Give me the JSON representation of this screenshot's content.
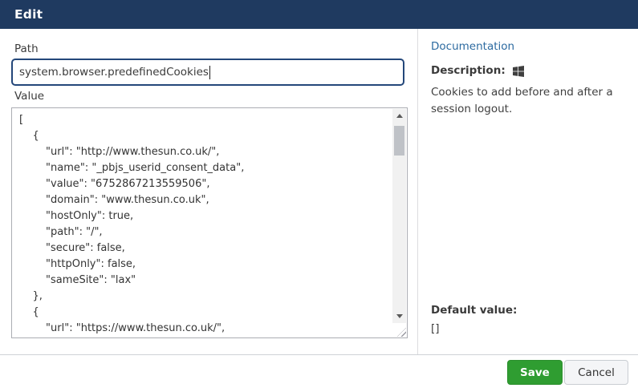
{
  "dialog": {
    "title": "Edit"
  },
  "form": {
    "path_label": "Path",
    "path_value": "system.browser.predefinedCookies",
    "value_label": "Value",
    "value_content": "[\n    {\n        \"url\": \"http://www.thesun.co.uk/\",\n        \"name\": \"_pbjs_userid_consent_data\",\n        \"value\": \"6752867213559506\",\n        \"domain\": \"www.thesun.co.uk\",\n        \"hostOnly\": true,\n        \"path\": \"/\",\n        \"secure\": false,\n        \"httpOnly\": false,\n        \"sameSite\": \"lax\"\n    },\n    {\n        \"url\": \"https://www.thesun.co.uk/\","
  },
  "docs": {
    "link_label": "Documentation",
    "description_label": "Description:",
    "platform_icon": "windows-icon",
    "description_text": "Cookies to add before and after a session logout.",
    "default_value_label": "Default value:",
    "default_value": "[]"
  },
  "actions": {
    "save_label": "Save",
    "cancel_label": "Cancel"
  },
  "colors": {
    "header_bg": "#1f3a60",
    "input_focus_border": "#24477a",
    "link_blue": "#2c6aa0",
    "save_green": "#2f9d31",
    "scrollbar_track": "#f1f1f1",
    "scrollbar_thumb": "#bfc2c7"
  }
}
